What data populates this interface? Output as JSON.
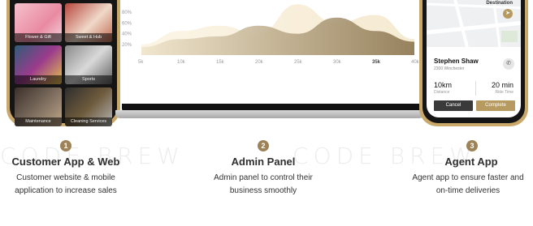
{
  "watermark": "CODE BREW",
  "customer_app": {
    "tiles": [
      {
        "label": "Flower & Gift",
        "color": "#e98aa2"
      },
      {
        "label": "Sweet & Hub",
        "color": "#c06a52"
      },
      {
        "label": "Laundry",
        "color": "#9b3b8c"
      },
      {
        "label": "Sports",
        "color": "#8a8a8a"
      },
      {
        "label": "Maintenance",
        "color": "#7a6a5c"
      },
      {
        "label": "Cleaning Services",
        "color": "#6e5a3c"
      }
    ]
  },
  "admin_chart": {
    "y_ticks": [
      "80%",
      "60%",
      "40%",
      "20%"
    ],
    "x_ticks": [
      "5k",
      "10k",
      "15k",
      "20k",
      "25k",
      "30k",
      "35k",
      "40k"
    ],
    "highlight_tick": "35k"
  },
  "chart_data": {
    "type": "area",
    "x": [
      5,
      10,
      15,
      20,
      25,
      30,
      35,
      40
    ],
    "xlabel": "",
    "ylabel": "",
    "ylim": [
      0,
      100
    ],
    "series": [
      {
        "values": [
          20,
          45,
          55,
          40,
          95,
          60,
          75,
          30
        ]
      },
      {
        "values": [
          15,
          30,
          35,
          55,
          40,
          70,
          45,
          25
        ]
      }
    ],
    "colors": [
      "#f3e6c9",
      "#8c7650"
    ]
  },
  "agent_app": {
    "destination_label": "Destination",
    "agent_name": "Stephen Shaw",
    "agent_address": "2300 Winchester",
    "distance_value": "10km",
    "distance_label": "Distance",
    "time_value": "20 min",
    "time_label": "Ride Time",
    "cancel_label": "Cancel",
    "complete_label": "Complete"
  },
  "features": [
    {
      "number": "1",
      "title": "Customer App & Web",
      "line1": "Customer website & mobile",
      "line2": "application to increase sales"
    },
    {
      "number": "2",
      "title": "Admin Panel",
      "line1": "Admin panel to control their",
      "line2": "business smoothly"
    },
    {
      "number": "3",
      "title": "Agent App",
      "line1": "Agent app to ensure faster and",
      "line2": "on-time deliveries"
    }
  ],
  "colors": {
    "accent": "#9e8358",
    "gold": "#b79a5f",
    "dark": "#151515"
  }
}
